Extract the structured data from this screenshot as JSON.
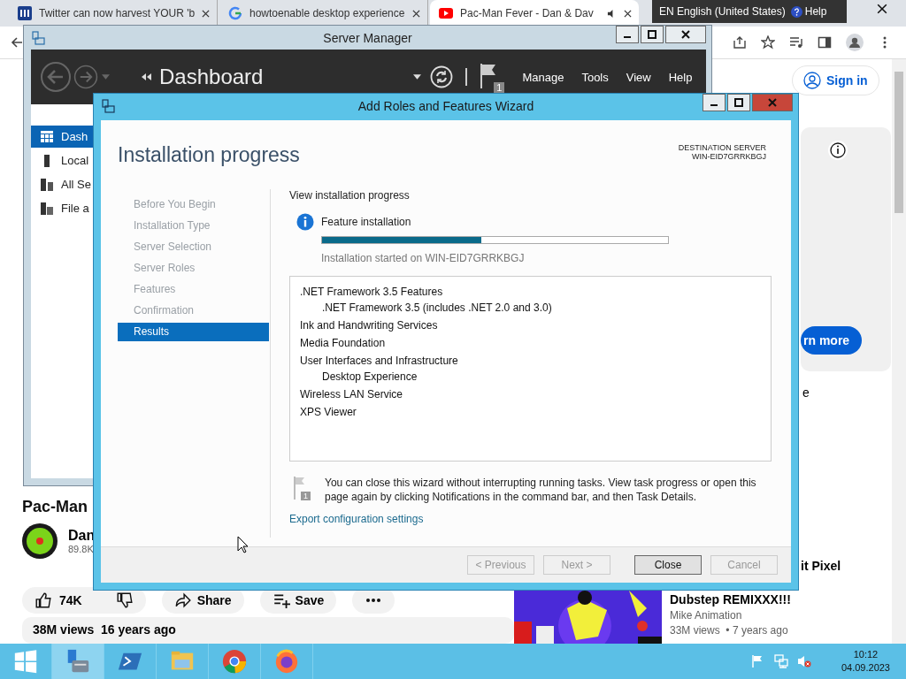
{
  "browser": {
    "tabs": [
      {
        "title": "Twitter can now harvest YOUR 'b",
        "selected": false,
        "kind": "news"
      },
      {
        "title": "howtoenable desktop experience",
        "selected": false,
        "kind": "search"
      },
      {
        "title": "Pac-Man Fever - Dan & Dav",
        "selected": true,
        "kind": "video"
      }
    ],
    "sign_in": "Sign in",
    "ad_button": "rn more",
    "ad_fragment": "e",
    "video_title": "Pac-Man",
    "channel": "Dan",
    "subscribers": "89.8K",
    "likes": "74K",
    "share": "Share",
    "save": "Save",
    "description": "38M views  16 years ago",
    "related": {
      "title_fragment": "it Pixel",
      "title": "Dubstep REMIXXX!!!",
      "channel": "Mike Animation",
      "meta": "33M views  • 7 years ago"
    }
  },
  "language_bar": {
    "language": "EN English (United States)",
    "help": "Help"
  },
  "server_manager": {
    "title": "Server Manager",
    "breadcrumb": "Dashboard",
    "notifications": "1",
    "menu": [
      "Manage",
      "Tools",
      "View",
      "Help"
    ],
    "sidebar": [
      {
        "label": "Dash",
        "selected": true,
        "kind": "dashboard"
      },
      {
        "label": "Local",
        "selected": false,
        "kind": "server"
      },
      {
        "label": "All Se",
        "selected": false,
        "kind": "servers"
      },
      {
        "label": "File a",
        "selected": false,
        "kind": "files"
      }
    ]
  },
  "wizard": {
    "title": "Add Roles and Features Wizard",
    "heading": "Installation progress",
    "destination_label": "DESTINATION SERVER",
    "destination_server": "WIN-EID7GRRKBGJ",
    "steps": [
      {
        "label": "Before You Begin",
        "selected": false
      },
      {
        "label": "Installation Type",
        "selected": false
      },
      {
        "label": "Server Selection",
        "selected": false
      },
      {
        "label": "Server Roles",
        "selected": false
      },
      {
        "label": "Features",
        "selected": false
      },
      {
        "label": "Confirmation",
        "selected": false
      },
      {
        "label": "Results",
        "selected": true
      }
    ],
    "section_label": "View installation progress",
    "status": "Feature installation",
    "progress": {
      "level": 0.46
    },
    "started": "Installation started on WIN-EID7GRRKBGJ",
    "features": [
      {
        "label": ".NET Framework 3.5 Features",
        "children": [
          {
            "label": ".NET Framework 3.5 (includes .NET 2.0 and 3.0)"
          }
        ]
      },
      {
        "label": "Ink and Handwriting Services"
      },
      {
        "label": "Media Foundation"
      },
      {
        "label": "User Interfaces and Infrastructure",
        "children": [
          {
            "label": "Desktop Experience"
          }
        ]
      },
      {
        "label": "Wireless LAN Service"
      },
      {
        "label": "XPS Viewer"
      }
    ],
    "notice_count": "1",
    "notice": "You can close this wizard without interrupting running tasks. View task progress or open this page again by clicking Notifications in the command bar, and then Task Details.",
    "export_link": "Export configuration settings",
    "buttons": [
      {
        "label": "< Previous",
        "disabled": true
      },
      {
        "label": "Next >",
        "disabled": true
      },
      {
        "label": "Close",
        "disabled": false
      },
      {
        "label": "Cancel",
        "disabled": true
      }
    ]
  },
  "taskbar": {
    "apps": [
      {
        "kind": "start",
        "selected": false
      },
      {
        "kind": "server-manager",
        "selected": true
      },
      {
        "kind": "powershell",
        "selected": false
      },
      {
        "kind": "explorer",
        "selected": false
      },
      {
        "kind": "chrome",
        "selected": false
      },
      {
        "kind": "firefox",
        "selected": false
      }
    ],
    "time": "10:12",
    "date": "04.09.2023"
  }
}
